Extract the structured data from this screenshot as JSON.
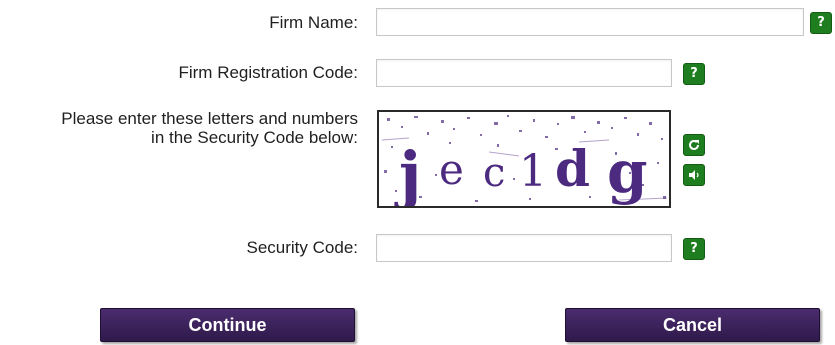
{
  "form": {
    "firm_name_label": "Firm Name:",
    "firm_name_value": "",
    "firm_reg_label": "Firm Registration Code:",
    "firm_reg_value": "",
    "captcha_instruction_line1": "Please enter these letters and numbers",
    "captcha_instruction_line2": "in the Security Code below:",
    "captcha_text": "jec1dg",
    "security_code_label": "Security Code:",
    "security_code_value": "",
    "help_symbol": "?"
  },
  "icons": {
    "help": "help-icon",
    "refresh": "refresh-icon",
    "audio": "audio-icon"
  },
  "buttons": {
    "continue_label": "Continue",
    "cancel_label": "Cancel"
  },
  "colors": {
    "help_green": "#1e7d1e",
    "button_purple": "#3d2460",
    "captcha_purple": "#4b2a80"
  }
}
